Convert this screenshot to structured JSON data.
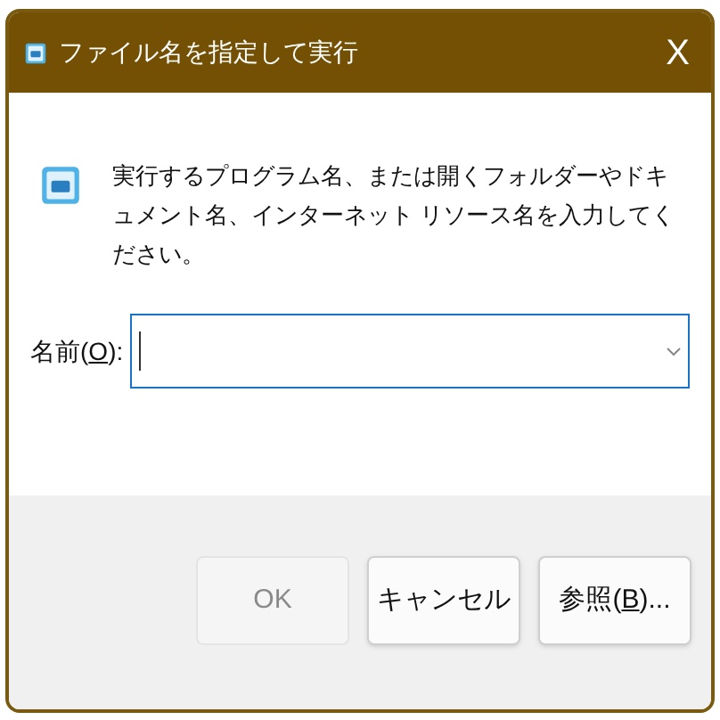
{
  "window": {
    "title": "ファイル名を指定して実行",
    "close": "X"
  },
  "message": "実行するプログラム名、または開くフォルダーやドキュメント名、インターネット リソース名を入力してください。",
  "name_field": {
    "label": [
      {
        "text": "名前(",
        "underline": false
      },
      {
        "text": "O",
        "underline": true
      },
      {
        "text": "):",
        "underline": false
      }
    ],
    "focused": true
  },
  "buttons": [
    {
      "label": [
        {
          "text": "OK",
          "underline": false
        }
      ],
      "disabled": true
    },
    {
      "label": [
        {
          "text": "キャンセル",
          "underline": false
        }
      ],
      "disabled": false
    },
    {
      "label": [
        {
          "text": "参照(",
          "underline": false
        },
        {
          "text": "B",
          "underline": true
        },
        {
          "text": ")...",
          "underline": false
        }
      ],
      "disabled": false
    }
  ]
}
